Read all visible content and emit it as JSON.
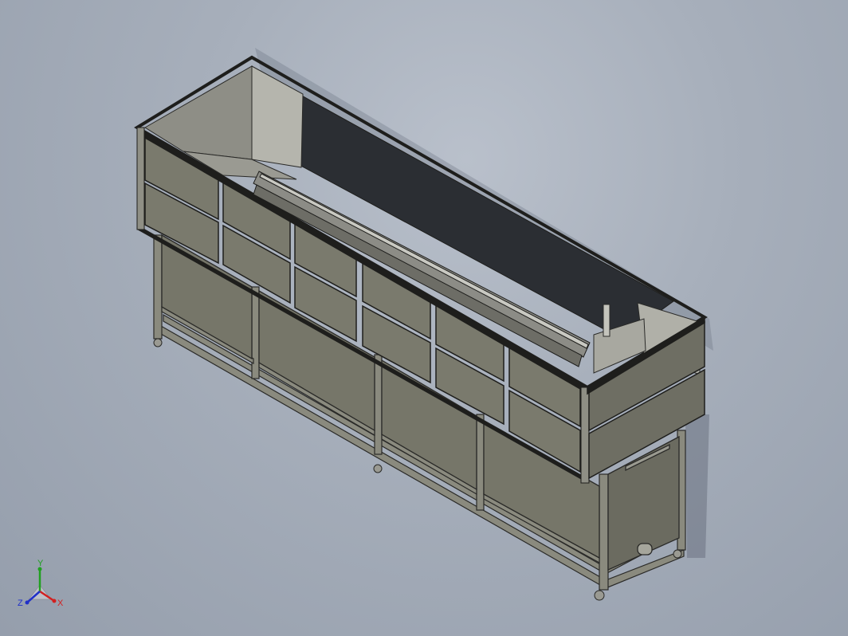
{
  "viewport": {
    "background_top": "#b9c0cb",
    "background_bottom": "#959eac"
  },
  "model": {
    "panel_color": "#76766a",
    "panel_dark": "#5e5e54",
    "interior_color": "#2b2e33",
    "frame_color": "#2a2a28",
    "steel_color": "#85857a"
  },
  "triad": {
    "x_label": "X",
    "y_label": "Y",
    "z_label": "Z",
    "x_color": "#d22020",
    "y_color": "#20a020",
    "z_color": "#2030c8"
  }
}
